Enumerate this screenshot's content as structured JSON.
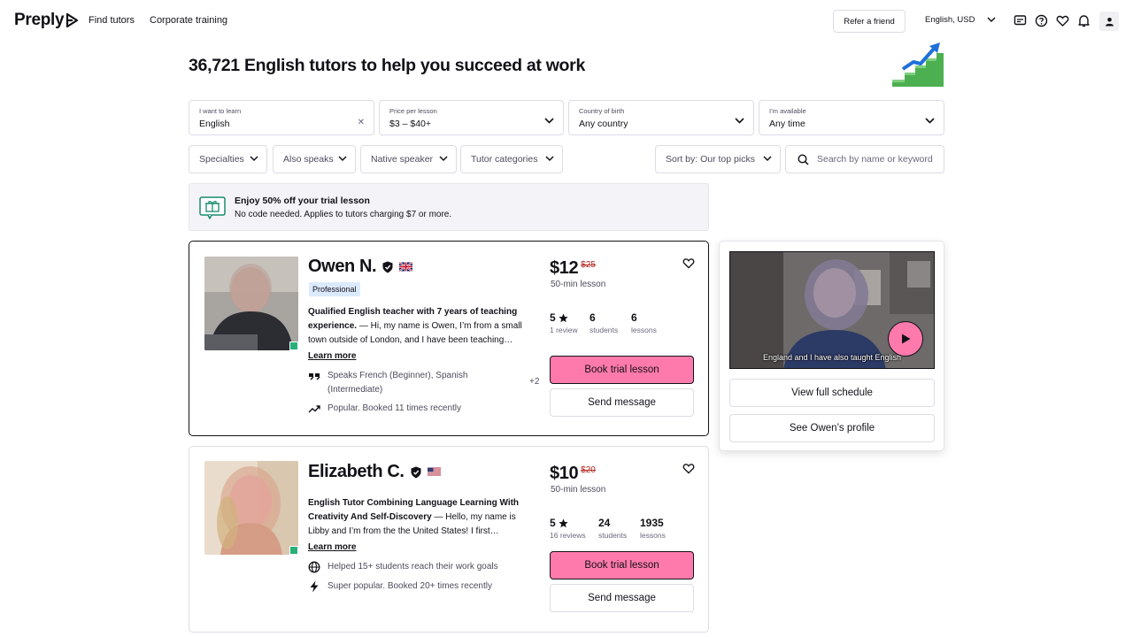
{
  "header": {
    "logo": "Preply",
    "nav": [
      "Find tutors",
      "Corporate training"
    ],
    "refer_label": "Refer a friend",
    "language": "English, USD",
    "icons": [
      "chat-icon",
      "help-icon",
      "heart-icon",
      "bell-icon",
      "user-icon"
    ]
  },
  "page": {
    "title": "36,721 English tutors to help you succeed at work"
  },
  "filters": {
    "learn": {
      "label": "I want to learn",
      "value": "English"
    },
    "price": {
      "label": "Price per lesson",
      "value": "$3 – $40+"
    },
    "country": {
      "label": "Country of birth",
      "value": "Any country"
    },
    "available": {
      "label": "I’m available",
      "value": "Any time"
    },
    "pills": [
      "Specialties",
      "Also speaks",
      "Native speaker",
      "Tutor categories"
    ],
    "sort": "Sort by: Our top picks",
    "search_placeholder": "Search by name or keyword"
  },
  "promo": {
    "title": "Enjoy 50% off your trial lesson",
    "subtitle": "No code needed. Applies to tutors charging $7 or more."
  },
  "tutors": [
    {
      "name": "Owen N.",
      "flag": "gb-flag",
      "badge": "Professional",
      "headline": "Qualified English teacher with 7 years of teaching experience.",
      "bio": " — Hi, my name is Owen, I’m from a small town outside of London, and I have been teaching…",
      "learn_more": "Learn more",
      "speaks": "Speaks French (Beginner), Spanish (Intermediate)",
      "speaks_more": "+2",
      "popular": "Popular. Booked 11 times recently",
      "price": "$12",
      "old_price": "$25",
      "lesson_len": "50-min lesson",
      "rating": "5",
      "reviews": "1 review",
      "students": "6",
      "students_lbl": "students",
      "lessons": "6",
      "lessons_lbl": "lessons",
      "book_label": "Book trial lesson",
      "message_label": "Send message"
    },
    {
      "name": "Elizabeth C.",
      "flag": "us-flag",
      "headline": "English Tutor Combining Language Learning With Creativity And Self-Discovery",
      "bio": " — Hello, my name is Libby and I’m from the the United States! I first…",
      "learn_more": "Learn more",
      "goals": "Helped 15+ students reach their work goals",
      "popular": "Super popular. Booked 20+ times recently",
      "price": "$10",
      "old_price": "$20",
      "lesson_len": "50-min lesson",
      "rating": "5",
      "reviews": "16 reviews",
      "students": "24",
      "students_lbl": "students",
      "lessons": "1935",
      "lessons_lbl": "lessons",
      "book_label": "Book trial lesson",
      "message_label": "Send message"
    }
  ],
  "side_panel": {
    "video_caption": "England and I have also taught English",
    "schedule_label": "View full schedule",
    "profile_label": "See Owen’s profile"
  },
  "colors": {
    "accent_pink": "#ff7aac",
    "text": "#121117",
    "old_price": "#b3261e",
    "online": "#27b07a"
  }
}
